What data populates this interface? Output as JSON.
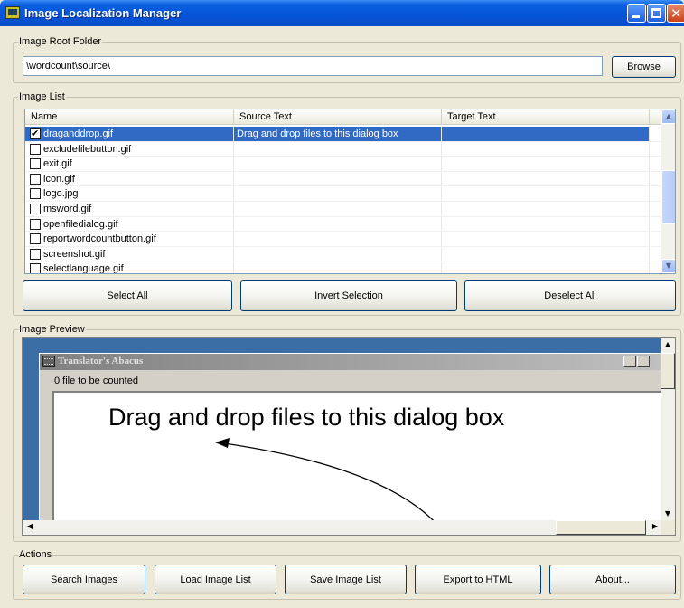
{
  "window": {
    "title": "Image Localization Manager"
  },
  "root_folder": {
    "legend": "Image Root Folder",
    "path_value": "\\wordcount\\source\\",
    "browse_label": "Browse"
  },
  "image_list": {
    "legend": "Image List",
    "columns": [
      "Name",
      "Source Text",
      "Target Text"
    ],
    "rows": [
      {
        "checked": true,
        "name": "draganddrop.gif",
        "source": "Drag and drop files to this dialog box",
        "target": "",
        "selected": true
      },
      {
        "checked": false,
        "name": "excludefilebutton.gif",
        "source": "",
        "target": ""
      },
      {
        "checked": false,
        "name": "exit.gif",
        "source": "",
        "target": ""
      },
      {
        "checked": false,
        "name": "icon.gif",
        "source": "",
        "target": ""
      },
      {
        "checked": false,
        "name": "logo.jpg",
        "source": "",
        "target": ""
      },
      {
        "checked": false,
        "name": "msword.gif",
        "source": "",
        "target": ""
      },
      {
        "checked": false,
        "name": "openfiledialog.gif",
        "source": "",
        "target": ""
      },
      {
        "checked": false,
        "name": "reportwordcountbutton.gif",
        "source": "",
        "target": ""
      },
      {
        "checked": false,
        "name": "screenshot.gif",
        "source": "",
        "target": ""
      },
      {
        "checked": false,
        "name": "selectlanguage.gif",
        "source": "",
        "target": ""
      }
    ],
    "select_all_label": "Select All",
    "invert_selection_label": "Invert Selection",
    "deselect_all_label": "Deselect All"
  },
  "preview": {
    "legend": "Image Preview",
    "inner_window_title": "Translator's Abacus",
    "inner_status": "0 file to be counted",
    "drop_text": "Drag and drop files to this dialog box"
  },
  "actions": {
    "legend": "Actions",
    "search_images_label": "Search Images",
    "load_list_label": "Load Image List",
    "save_list_label": "Save Image List",
    "export_html_label": "Export to HTML",
    "about_label": "About..."
  },
  "colors": {
    "title_bar": "#0453d8",
    "selection": "#316ac5",
    "preview_bg": "#3a6ea5"
  },
  "icons": [
    "app-icon",
    "minimize-icon",
    "maximize-icon",
    "close-icon",
    "checkbox-icon",
    "scroll-up-icon",
    "scroll-down-icon",
    "scroll-left-icon",
    "scroll-right-icon"
  ]
}
